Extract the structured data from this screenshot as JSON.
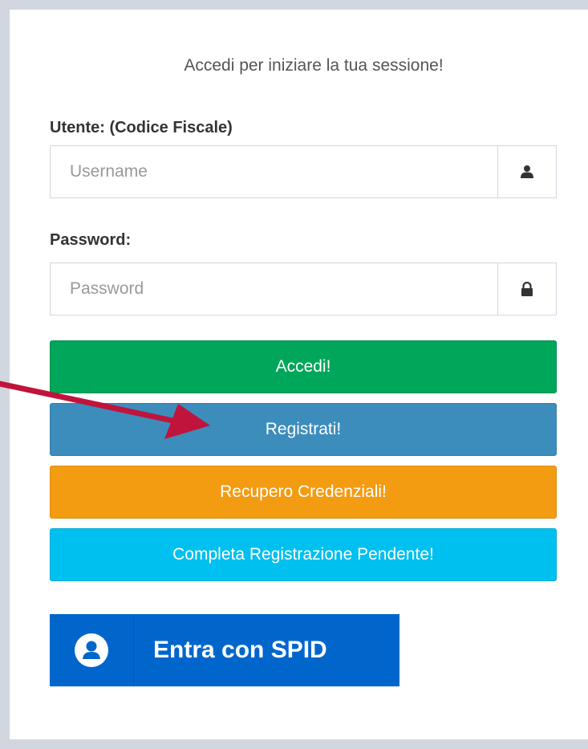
{
  "login": {
    "session_message": "Accedi per iniziare la tua sessione!",
    "username": {
      "label": "Utente: (Codice Fiscale)",
      "placeholder": "Username",
      "value": "",
      "icon": "user-icon"
    },
    "password": {
      "label": "Password:",
      "placeholder": "Password",
      "value": "",
      "icon": "lock-icon"
    },
    "buttons": {
      "accedi": "Accedi!",
      "registrati": "Registrati!",
      "recupero": "Recupero Credenziali!",
      "completa": "Completa Registrazione Pendente!"
    },
    "spid": {
      "label": "Entra con SPID",
      "icon": "spid-user-icon"
    }
  },
  "colors": {
    "background": "#d2d6de",
    "accedi": "#00a65a",
    "registrati": "#3c8dbc",
    "recupero": "#f39c12",
    "completa": "#00c0ef",
    "spid": "#0066cc",
    "annotation_arrow": "#c0143c"
  }
}
